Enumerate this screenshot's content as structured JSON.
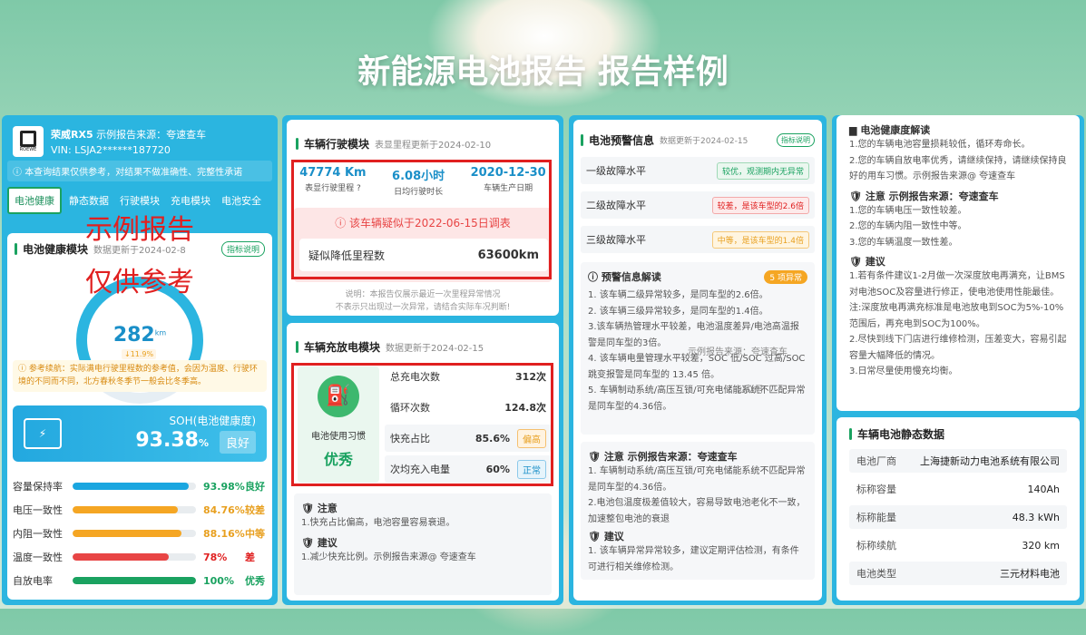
{
  "headline": "新能源电池报告 报告样例",
  "car": {
    "model": "荣威RX5",
    "source": "示例报告来源：夸速查车",
    "vin_label": "VIN:",
    "vin": "LSJA2******187720",
    "disclaimer": "本查询结果仅供参考，对结果不做准确性、完整性承诺",
    "logo_text": "ROEWE"
  },
  "tabs": [
    "电池健康",
    "静态数据",
    "行驶模块",
    "充电模块",
    "电池安全"
  ],
  "watermark": {
    "line1": "示例报告",
    "line2": "仅供参考"
  },
  "health": {
    "title": "电池健康模块",
    "date": "数据更新于2024-02-8",
    "info_btn": "指标说明",
    "gauge_value": "282",
    "gauge_unit": "km",
    "gauge_change": "↓11.9%",
    "ref_text": "参考续航：实际满电行驶里程数的参考值，会因为温度、行驶环境的不同而不同，北方春秋冬季节一般会比冬季高。",
    "soh_label": "SOH(电池健康度)",
    "soh_value": "93.38",
    "soh_unit": "%",
    "soh_grade": "良好",
    "metrics": [
      {
        "label": "容量保持率",
        "value": "93.98%",
        "grade": "良好",
        "pct": 0.94,
        "color": "#1aa6e0",
        "gcolor": "#1aa260"
      },
      {
        "label": "电压一致性",
        "value": "84.76%",
        "grade": "较差",
        "pct": 0.85,
        "color": "#f5a623",
        "gcolor": "#e8a020"
      },
      {
        "label": "内阻一致性",
        "value": "88.16%",
        "grade": "中等",
        "pct": 0.88,
        "color": "#f5a623",
        "gcolor": "#e8a020"
      },
      {
        "label": "温度一致性",
        "value": "78%",
        "grade": "差",
        "pct": 0.78,
        "color": "#e84545",
        "gcolor": "#e02020"
      },
      {
        "label": "自放电率",
        "value": "100%",
        "grade": "优秀",
        "pct": 1.0,
        "color": "#1aa260",
        "gcolor": "#1aa260"
      }
    ]
  },
  "driving": {
    "title": "车辆行驶模块",
    "date": "表显里程更新于2024-02-10",
    "stats": [
      {
        "value": "47774 Km",
        "label": "表显行驶里程"
      },
      {
        "value": "6.08小时",
        "label": "日均行驶时长"
      },
      {
        "value": "2020-12-30",
        "label": "车辆生产日期"
      }
    ],
    "alert": "该车辆疑似于2022-06-15日调表",
    "min_label": "疑似降低里程数",
    "min_value": "63600km",
    "note": "说明：本报告仅展示最近一次里程异常情况\n不表示只出现过一次异常，请结合实际车况判断!"
  },
  "charging": {
    "title": "车辆充放电模块",
    "date": "数据更新于2024-02-15",
    "habit_label": "电池使用习惯",
    "habit_value": "优秀",
    "rows": [
      {
        "label": "总充电次数",
        "value": "312次",
        "tag": ""
      },
      {
        "label": "循环次数",
        "value": "124.8次",
        "tag": ""
      },
      {
        "label": "快充占比",
        "value": "85.6%",
        "tag": "偏高"
      },
      {
        "label": "次均充入电量",
        "value": "60%",
        "tag": "正常"
      }
    ],
    "notice_title": "注意",
    "notice_text": "1.快充占比偏高，电池容量容易衰退。",
    "advice_title": "建议",
    "advice_text": "1.减少快充比例。示例报告来源@ 夸速查车"
  },
  "warning": {
    "title": "电池预警信息",
    "date": "数据更新于2024-02-15",
    "info_btn": "指标说明",
    "levels": [
      {
        "label": "一级故障水平",
        "tag": "较优，观测期内无异常",
        "type": "green"
      },
      {
        "label": "二级故障水平",
        "tag": "较差，是该车型的2.6倍",
        "type": "red"
      },
      {
        "label": "三级故障水平",
        "tag": "中等，是该车型的1.4倍",
        "type": "orange"
      }
    ],
    "interp_title": "预警信息解读",
    "interp_badge": "5 项异常",
    "interp_items": [
      "1. 该车辆二级异常较多，是同车型的2.6倍。",
      "2. 该车辆三级异常较多，是同车型的1.4倍。",
      "3.该车辆热管理水平较差，电池温度差异/电池高温报警是同车型的3倍。",
      "4. 该车辆电量管理水平较差，SOC 低/SOC 过高/SOC 跳变报警是同车型的 13.45 倍。",
      "5. 车辆制动系统/高压互锁/可充电储能系统不匹配异常是同车型的4.36倍。"
    ],
    "wm1": "示例报告来源：夸速查车",
    "wm2": "公众号",
    "notice_title": "注意 示例报告来源：夸速查车",
    "notice_items": [
      "1. 车辆制动系统/高压互锁/可充电储能系统不匹配异常是同车型的4.36倍。",
      "2.电池包温度极差值较大，容易导致电池老化不一致，加速整包电池的衰退"
    ],
    "advice_title": "建议",
    "advice_items": [
      "1. 该车辆异常异常较多，建议定期评估检测，有条件可进行相关维修检测。"
    ]
  },
  "health_interp": {
    "title": "电池健康度解读",
    "items": [
      "1.您的车辆电池容量损耗较低，循环寿命长。",
      "2.您的车辆自放电率优秀，请继续保持，请继续保持良好的用车习惯。示例报告来源@ 夸速查车"
    ],
    "notice_title": "注意 示例报告来源：夸速查车",
    "notice_items": [
      "1.您的车辆电压一致性较差。",
      "2.您的车辆内阻一致性中等。",
      "3.您的车辆温度一致性差。"
    ],
    "advice_title": "建议",
    "advice_items": [
      "1.若有条件建议1-2月做一次深度放电再满充，让BMS对电池SOC及容量进行修正，使电池使用性能最佳。",
      "注:深度放电再满充标准是电池放电到SOC为5%-10%范围后，再充电到SOC为100%。",
      "2.尽快到线下门店进行维修检测，压差变大，容易引起容量大幅降低的情况。",
      "3.日常尽量使用慢充均衡。"
    ]
  },
  "static": {
    "title": "车辆电池静态数据",
    "rows": [
      {
        "label": "电池厂商",
        "value": "上海捷新动力电池系统有限公司"
      },
      {
        "label": "标称容量",
        "value": "140Ah"
      },
      {
        "label": "标称能量",
        "value": "48.3 kWh"
      },
      {
        "label": "标称续航",
        "value": "320 km"
      },
      {
        "label": "电池类型",
        "value": "三元材料电池"
      }
    ]
  }
}
